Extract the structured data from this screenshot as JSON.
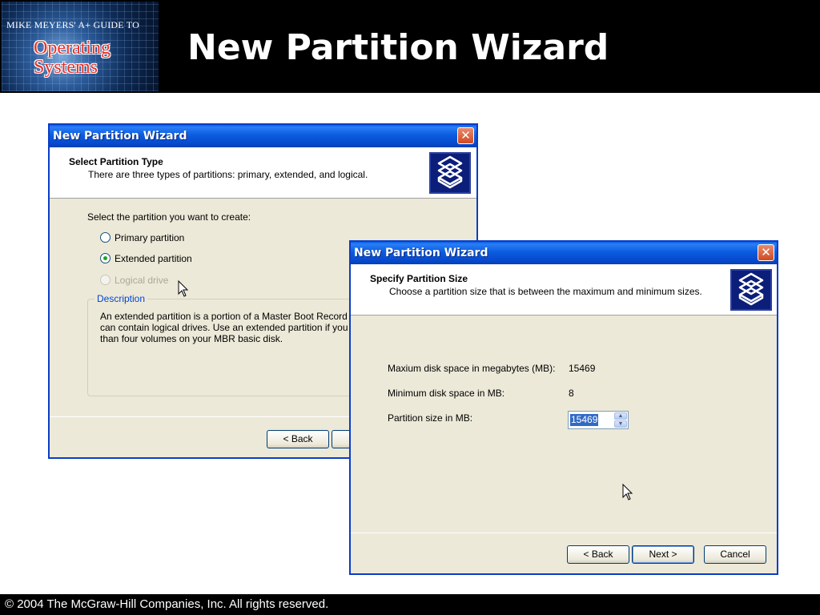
{
  "slide": {
    "logo": {
      "line1": "MIKE MEYERS' A+ GUIDE TO",
      "line2": "Operating",
      "line3": "Systems"
    },
    "title": "New Partition Wizard",
    "footer": "© 2004 The McGraw-Hill Companies, Inc. All rights reserved."
  },
  "dialog1": {
    "title": "New Partition Wizard",
    "close_icon": "close-icon",
    "header_title": "Select Partition Type",
    "header_subtitle": "There are three types of partitions: primary, extended, and logical.",
    "prompt": "Select the partition you want to create:",
    "options": [
      {
        "label": "Primary partition",
        "checked": false,
        "enabled": true
      },
      {
        "label": "Extended partition",
        "checked": true,
        "enabled": true
      },
      {
        "label": "Logical drive",
        "checked": false,
        "enabled": false
      }
    ],
    "description_legend": "Description",
    "description_lines": [
      "An extended partition is a portion of a Master Boot Record (MB",
      "can contain logical drives. Use an extended partition if you wa",
      "than four volumes on your MBR basic disk."
    ],
    "back_label": "< Back"
  },
  "dialog2": {
    "title": "New Partition Wizard",
    "close_icon": "close-icon",
    "header_title": "Specify Partition Size",
    "header_subtitle": "Choose a partition size that is between the maximum and minimum sizes.",
    "max_label": "Maxium disk space in megabytes (MB):",
    "max_value": "15469",
    "min_label": "Minimum disk space in MB:",
    "min_value": "8",
    "size_label": "Partition size in MB:",
    "size_value": "15469",
    "back_label": "< Back",
    "next_label": "Next >",
    "cancel_label": "Cancel"
  },
  "colors": {
    "titlebar": "#0a5fe6",
    "dialog_bg": "#ece9d8",
    "selection": "#316ac5",
    "close_button": "#cf4a22"
  }
}
